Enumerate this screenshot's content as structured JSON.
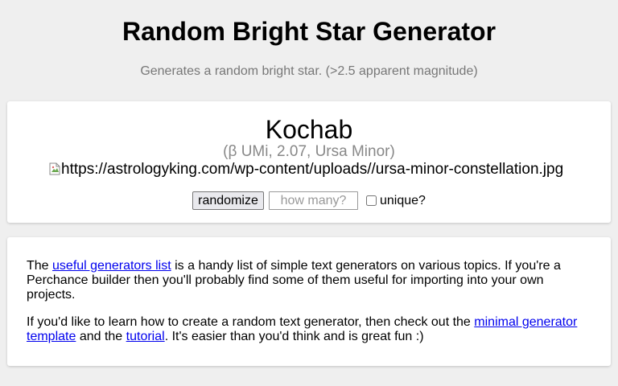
{
  "header": {
    "title": "Random Bright Star Generator",
    "subtitle": "Generates a random bright star. (>2.5 apparent magnitude)"
  },
  "generator": {
    "star_name": "Kochab",
    "star_details": "(β UMi, 2.07, Ursa Minor)",
    "image_alt": "https://astrologyking.com/wp-content/uploads//ursa-minor-constellation.jpg",
    "image_icon": "broken-image-icon",
    "randomize_label": "randomize",
    "count_placeholder": "how many?",
    "count_value": "",
    "unique_label": "unique?",
    "unique_checked": false
  },
  "info": {
    "p1_before": "The ",
    "p1_link": "useful generators list",
    "p1_after": " is a handy list of simple text generators on various topics. If you're a Perchance builder then you'll probably find some of them useful for importing into your own projects.",
    "p2_before": "If you'd like to learn how to create a random text generator, then check out the ",
    "p2_link1": "minimal generator template",
    "p2_middle": " and the ",
    "p2_link2": "tutorial",
    "p2_after": ". It's easier than you'd think and is great fun :)"
  },
  "colors": {
    "background": "#efefef",
    "card": "#ffffff",
    "subtitle_text": "#777777",
    "details_text": "#888888",
    "link": "#0000ee"
  }
}
